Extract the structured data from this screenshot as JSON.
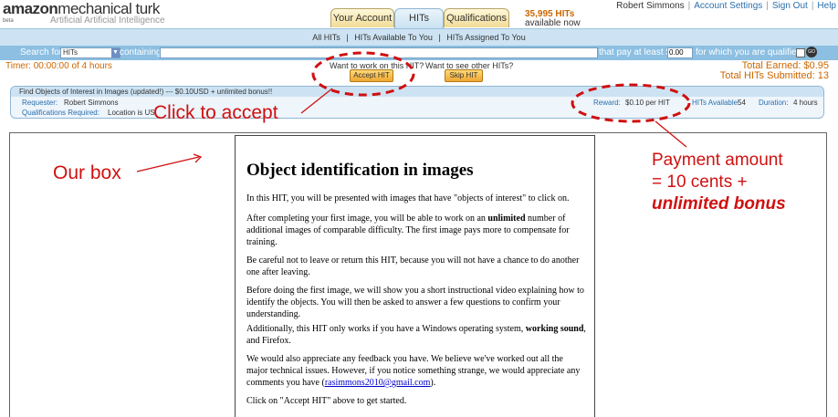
{
  "header": {
    "logo_amazon": "amazon",
    "logo_turk": "mechanical turk",
    "logo_sub": "Artificial Artificial Intelligence",
    "logo_beta": "beta",
    "tabs": [
      {
        "label": "Your Account",
        "active": false
      },
      {
        "label": "HITs",
        "active": true
      },
      {
        "label": "Qualifications",
        "active": false
      }
    ],
    "hits_count": "35,995 HITs",
    "hits_available_now": "available now",
    "user_name": "Robert Simmons",
    "account_settings": "Account Settings",
    "sign_out": "Sign Out",
    "help": "Help"
  },
  "nav": {
    "all_hits": "All HITs",
    "available_to_you": "HITs Available To You",
    "assigned_to_you": "HITs Assigned To You",
    "separator": "|"
  },
  "search": {
    "search_for_label": "Search for",
    "select_value": "HITs",
    "containing_label": "containing",
    "containing_value": "",
    "pay_label": "that pay at least $",
    "pay_value": "0.00",
    "qualified_label": "for which you are qualified",
    "go_label": "GO"
  },
  "work": {
    "timer": "Timer: 00:00:00 of 4 hours",
    "want_work": "Want to work on this HIT?",
    "want_other": "Want to see other HITs?",
    "accept_label": "Accept HIT",
    "skip_label": "Skip HIT",
    "total_earned": "Total Earned: $0.95",
    "total_submitted": "Total HITs Submitted: 13"
  },
  "hit": {
    "title": "Find Objects of Interest in Images (updated!) --- $0.10USD + unlimited bonus!!",
    "requester_label": "Requester:",
    "requester_value": "Robert Simmons",
    "quals_label": "Qualifications Required:",
    "quals_value": "Location is US",
    "reward_label": "Reward:",
    "reward_value": "$0.10 per HIT",
    "available_label": "HITs Available:",
    "available_value": "54",
    "duration_label": "Duration:",
    "duration_value": "4 hours"
  },
  "document": {
    "title": "Object identification in images",
    "p1": "In this HIT, you will be presented with images that have \"objects of interest\" to click on.",
    "p2a": "After completing your first image, you will be able to work on an ",
    "p2b": "unlimited",
    "p2c": " number of additional images of comparable difficulty. The first image pays more to compensate for training.",
    "p3": "Be careful not to leave or return this HIT, because you will not have a chance to do another one after leaving.",
    "p4": "Before doing the first image, we will show you a short instructional video explaining how to identify the objects. You will then be asked to answer a few questions to confirm your understanding.",
    "p5a": "Additionally, this HIT only works if you have a Windows operating system, ",
    "p5b": "working sound",
    "p5c": ", and Firefox.",
    "p6a": "We would also appreciate any feedback you have. We believe we've worked out all the major technical issues. However, if you notice something strange, we would appreciate any comments you have (",
    "p6_email": "rasimmons2010@gmail.com",
    "p6b": ").",
    "p7": "Click on \"Accept HIT\" above to get started."
  },
  "annotations": {
    "click_to_accept": "Click to accept",
    "our_box": "Our box",
    "payment_line1": "Payment  amount",
    "payment_line2": "= 10 cents +",
    "payment_line3": "unlimited bonus",
    "color": "#d01010"
  }
}
